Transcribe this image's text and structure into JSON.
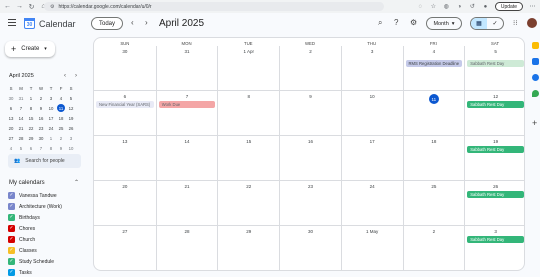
{
  "browser": {
    "url": "https://calendar.google.com/calendar/u/0/r",
    "update_label": "Update"
  },
  "header": {
    "app_title": "Calendar",
    "logo_text": "30",
    "today_label": "Today",
    "prev_icon": "chevron-left",
    "next_icon": "chevron-right",
    "period_title": "April 2025",
    "view_label": "Month"
  },
  "sidebar": {
    "create_label": "Create",
    "mini_title": "April 2025",
    "mini_dows": [
      "S",
      "M",
      "T",
      "W",
      "T",
      "F",
      "S"
    ],
    "mini_weeks": [
      [
        "30",
        "31",
        "1",
        "2",
        "3",
        "4",
        "5"
      ],
      [
        "6",
        "7",
        "8",
        "9",
        "10",
        "11",
        "12"
      ],
      [
        "13",
        "14",
        "15",
        "16",
        "17",
        "18",
        "19"
      ],
      [
        "20",
        "21",
        "22",
        "23",
        "24",
        "25",
        "26"
      ],
      [
        "27",
        "28",
        "29",
        "30",
        "1",
        "2",
        "3"
      ],
      [
        "4",
        "5",
        "6",
        "7",
        "8",
        "9",
        "10"
      ]
    ],
    "search_people": "Search for people",
    "my_calendars_title": "My calendars",
    "calendars": [
      {
        "name": "Vanessa Tandwe",
        "color": "#7986cb"
      },
      {
        "name": "Architecture (Work)",
        "color": "#7986cb"
      },
      {
        "name": "Birthdays",
        "color": "#33b679"
      },
      {
        "name": "Chores",
        "color": "#d50000"
      },
      {
        "name": "Church",
        "color": "#d50000"
      },
      {
        "name": "Classes",
        "color": "#f6bf26"
      },
      {
        "name": "Study Schedule",
        "color": "#33b679"
      },
      {
        "name": "Tasks",
        "color": "#039be5"
      }
    ]
  },
  "grid": {
    "dows": [
      "SUN",
      "MON",
      "TUE",
      "WED",
      "THU",
      "FRI",
      "SAT"
    ],
    "weeks": [
      [
        "30",
        "31",
        "1 Apr",
        "2",
        "3",
        "4",
        "5"
      ],
      [
        "6",
        "7",
        "8",
        "9",
        "10",
        "11",
        "12"
      ],
      [
        "13",
        "14",
        "15",
        "16",
        "17",
        "18",
        "19"
      ],
      [
        "20",
        "21",
        "22",
        "23",
        "24",
        "25",
        "26"
      ],
      [
        "27",
        "28",
        "29",
        "30",
        "1 May",
        "2",
        "3"
      ]
    ],
    "today": {
      "week": 1,
      "day": 5
    },
    "events": {
      "fri_week0": "RMS Registration Deadline",
      "sat_week0": "Sabbath Rest Day",
      "sun_week1": "New Financial Year (SARS)",
      "mon_week1": "Work Due",
      "sat_week1": "Sabbath Rest Day",
      "sat_week2": "Sabbath Rest Day",
      "sat_week3": "Sabbath Rest Day",
      "sat_week4": "Sabbath Rest Day"
    }
  },
  "colors": {
    "accent": "#0b57d0",
    "sabbath": "#33b679",
    "work_due": "#f4a6a6",
    "financial": "#c5cae9"
  }
}
